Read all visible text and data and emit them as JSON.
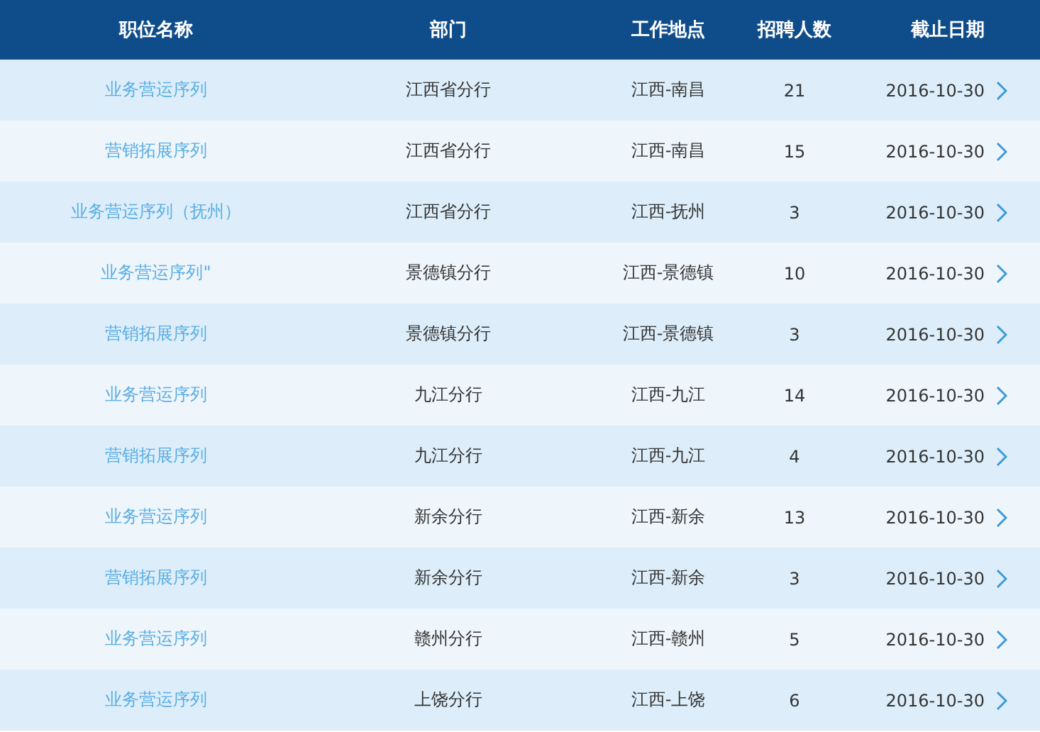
{
  "table": {
    "columns": [
      "职位名称",
      "部门",
      "工作地点",
      "招聘人数",
      "截止日期"
    ],
    "rows": [
      {
        "title": "业务营运序列",
        "department": "江西省分行",
        "location": "江西-南昌",
        "openings": "21",
        "deadline": "2016-10-30"
      },
      {
        "title": "营销拓展序列",
        "department": "江西省分行",
        "location": "江西-南昌",
        "openings": "15",
        "deadline": "2016-10-30"
      },
      {
        "title": "业务营运序列（抚州）",
        "department": "江西省分行",
        "location": "江西-抚州",
        "openings": "3",
        "deadline": "2016-10-30"
      },
      {
        "title": "业务营运序列\"",
        "department": "景德镇分行",
        "location": "江西-景德镇",
        "openings": "10",
        "deadline": "2016-10-30"
      },
      {
        "title": "营销拓展序列",
        "department": "景德镇分行",
        "location": "江西-景德镇",
        "openings": "3",
        "deadline": "2016-10-30"
      },
      {
        "title": "业务营运序列",
        "department": "九江分行",
        "location": "江西-九江",
        "openings": "14",
        "deadline": "2016-10-30"
      },
      {
        "title": "营销拓展序列",
        "department": "九江分行",
        "location": "江西-九江",
        "openings": "4",
        "deadline": "2016-10-30"
      },
      {
        "title": "业务营运序列",
        "department": "新余分行",
        "location": "江西-新余",
        "openings": "13",
        "deadline": "2016-10-30"
      },
      {
        "title": "营销拓展序列",
        "department": "新余分行",
        "location": "江西-新余",
        "openings": "3",
        "deadline": "2016-10-30"
      },
      {
        "title": "业务营运序列",
        "department": "赣州分行",
        "location": "江西-赣州",
        "openings": "5",
        "deadline": "2016-10-30"
      },
      {
        "title": "业务营运序列",
        "department": "上饶分行",
        "location": "江西-上饶",
        "openings": "6",
        "deadline": "2016-10-30"
      }
    ]
  }
}
